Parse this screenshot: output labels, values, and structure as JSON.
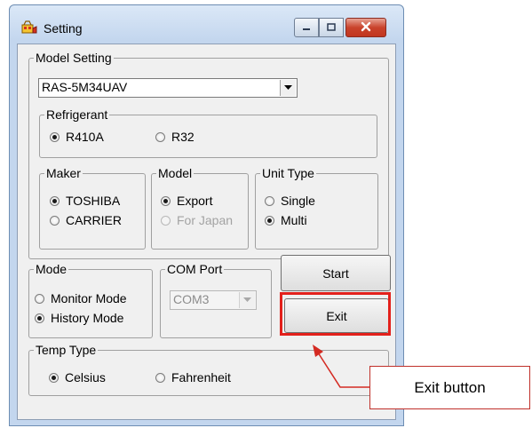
{
  "window": {
    "title": "Setting",
    "icon": "setting-app-icon",
    "controls": {
      "minimize": "minimize-icon",
      "maximize": "maximize-icon",
      "close": "close-icon"
    }
  },
  "model_setting": {
    "label": "Model Setting",
    "selected": "RAS-5M34UAV",
    "refrigerant": {
      "label": "Refrigerant",
      "options": [
        {
          "label": "R410A",
          "checked": true
        },
        {
          "label": "R32",
          "checked": false
        }
      ]
    },
    "maker": {
      "label": "Maker",
      "options": [
        {
          "label": "TOSHIBA",
          "checked": true
        },
        {
          "label": "CARRIER",
          "checked": false
        }
      ]
    },
    "model": {
      "label": "Model",
      "options": [
        {
          "label": "Export",
          "checked": true
        },
        {
          "label": "For Japan",
          "checked": false,
          "disabled": true
        }
      ]
    },
    "unit_type": {
      "label": "Unit Type",
      "options": [
        {
          "label": "Single",
          "checked": false
        },
        {
          "label": "Multi",
          "checked": true
        }
      ]
    }
  },
  "mode": {
    "label": "Mode",
    "options": [
      {
        "label": "Monitor Mode",
        "checked": false
      },
      {
        "label": "History Mode",
        "checked": true
      }
    ]
  },
  "com_port": {
    "label": "COM Port",
    "selected": "COM3",
    "disabled": true
  },
  "buttons": {
    "start": "Start",
    "exit": "Exit"
  },
  "temp_type": {
    "label": "Temp Type",
    "options": [
      {
        "label": "Celsius",
        "checked": true
      },
      {
        "label": "Fahrenheit",
        "checked": false
      }
    ]
  },
  "annotation": {
    "callout": "Exit button",
    "highlight_color": "#e3201b"
  }
}
